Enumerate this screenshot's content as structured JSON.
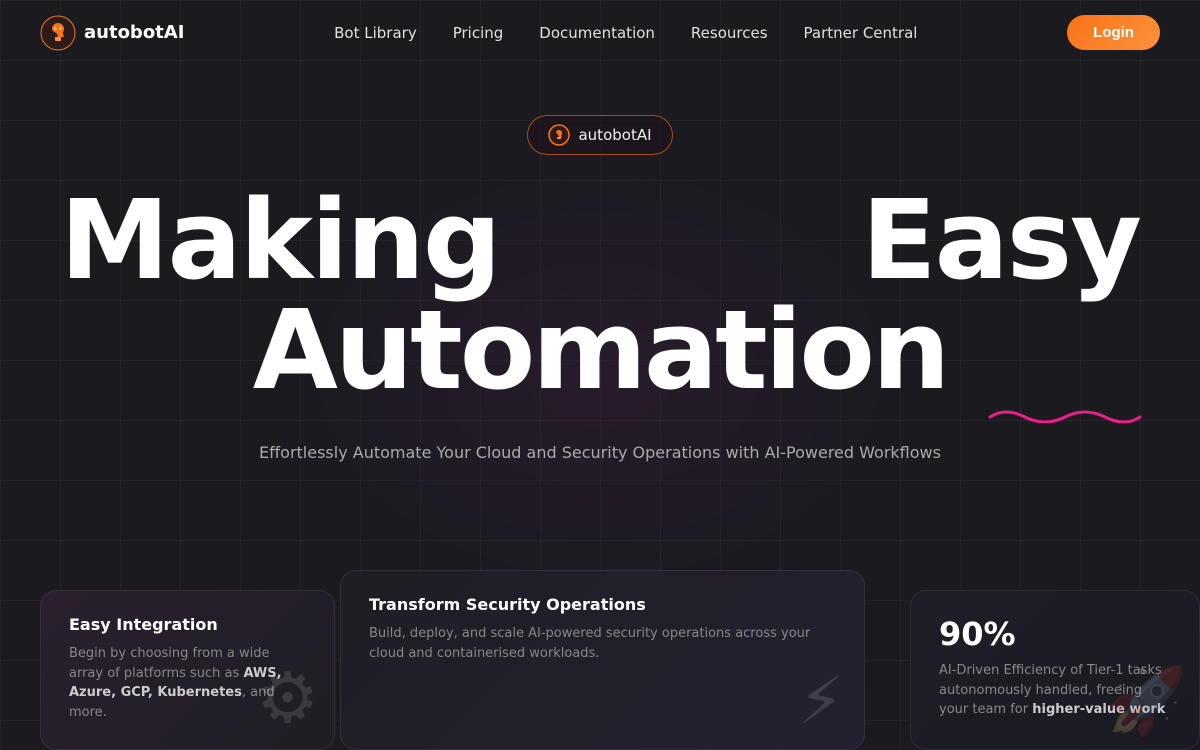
{
  "nav": {
    "logo_text": "autobotAI",
    "links": [
      {
        "label": "Bot Library",
        "id": "bot-library"
      },
      {
        "label": "Pricing",
        "id": "pricing"
      },
      {
        "label": "Documentation",
        "id": "documentation"
      },
      {
        "label": "Resources",
        "id": "resources"
      },
      {
        "label": "Partner Central",
        "id": "partner-central"
      }
    ],
    "login_label": "Login"
  },
  "hero": {
    "badge_text": "autobotAI",
    "headline_making": "Making",
    "headline_easy": "Easy",
    "headline_automation": "Automation",
    "subtext": "Effortlessly Automate Your Cloud and Security Operations with AI-Powered Workflows"
  },
  "cards": {
    "integration": {
      "title": "Easy Integration",
      "body_start": "Begin by choosing from a wide array of platforms such as ",
      "body_highlight": "AWS, Azure, GCP, Kubernetes",
      "body_end": ", and more."
    },
    "security": {
      "title": "Transform Security Operations",
      "body": "Build, deploy, and scale AI-powered security operations across your cloud and containerised workloads."
    },
    "efficiency": {
      "percent": "90%",
      "body_start": "AI-Driven Efficiency of Tier-1 tasks autonomously handled, freeing your team for ",
      "body_highlight": "higher-value work"
    }
  }
}
